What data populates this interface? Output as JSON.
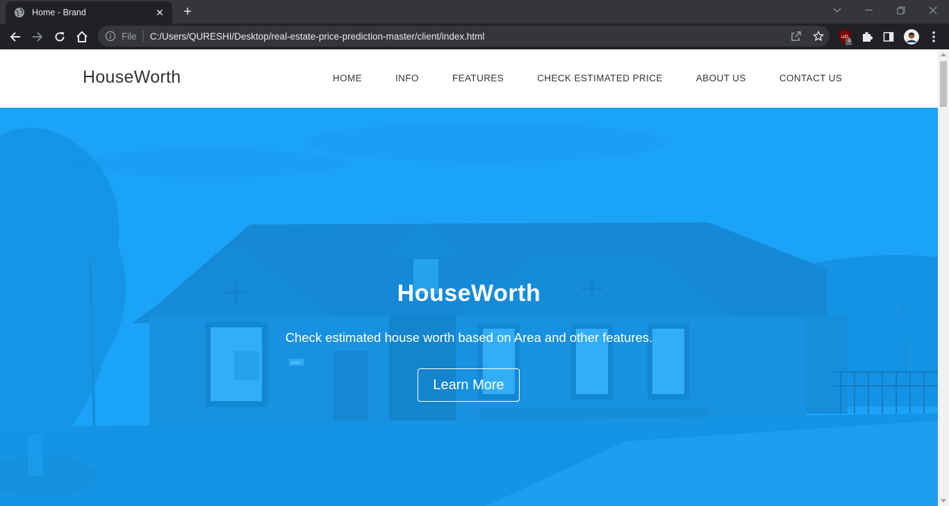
{
  "browser": {
    "tab_title": "Home - Brand",
    "address_scheme": "File",
    "address_url": "C:/Users/QURESHI/Desktop/real-estate-price-prediction-master/client/index.html",
    "extension_badge": "1"
  },
  "site": {
    "brand": "HouseWorth",
    "nav": [
      {
        "label": "HOME"
      },
      {
        "label": "INFO"
      },
      {
        "label": "FEATURES"
      },
      {
        "label": "CHECK ESTIMATED PRICE"
      },
      {
        "label": "ABOUT US"
      },
      {
        "label": "CONTACT US"
      }
    ]
  },
  "hero": {
    "title": "HouseWorth",
    "subtitle": "Check estimated house worth based on Area and other features.",
    "button_label": "Learn More",
    "house_number_sign": "1060"
  },
  "colors": {
    "hero_overlay": "#1ca0f2",
    "chrome_dark": "#202124",
    "tabstrip": "#35363a"
  }
}
